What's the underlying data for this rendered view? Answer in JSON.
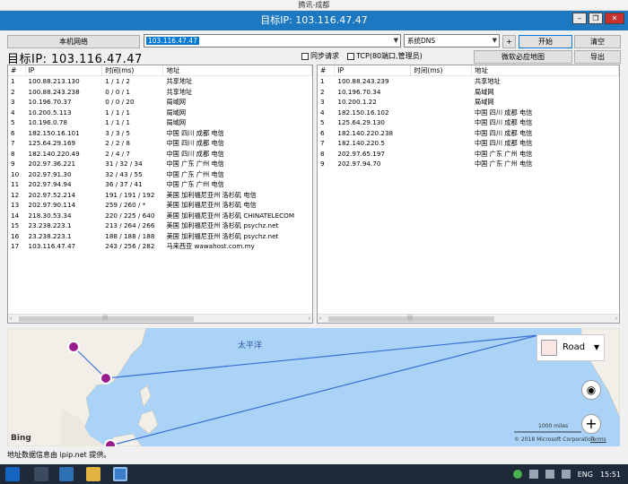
{
  "window": {
    "app_title": "腾讯-成都",
    "title": "目标IP: 103.116.47.47",
    "controls": {
      "minimize": "–",
      "restore": "❐",
      "close": "✕"
    }
  },
  "toolbar": {
    "local_network": "本机网络",
    "ip_value": "103.116.47.47",
    "dns_value": "系统DNS",
    "plus": "+",
    "start": "开始",
    "clear": "清空",
    "big_title": "目标IP:  103.116.47.47",
    "sync_request": "同步请求",
    "tcp_option": "TCP(80端口,管理员)",
    "weiruan_map": "微软必应地图",
    "export": "导出"
  },
  "left_table": {
    "headers": [
      "#",
      "IP",
      "时间(ms)",
      "地址"
    ],
    "rows": [
      [
        "1",
        "100.88.213.130",
        "1 / 1 / 2",
        "共享地址"
      ],
      [
        "2",
        "100.88.243.238",
        "0 / 0 / 1",
        "共享地址"
      ],
      [
        "3",
        "10.196.70.37",
        "0 / 0 / 20",
        "局域网"
      ],
      [
        "4",
        "10.200.5.113",
        "1 / 1 / 1",
        "局域网"
      ],
      [
        "5",
        "10.196.0.78",
        "1 / 1 / 1",
        "局域网"
      ],
      [
        "6",
        "182.150.16.101",
        "3 / 3 / 5",
        "中国 四川 成都 电信"
      ],
      [
        "7",
        "125.64.29.169",
        "2 / 2 / 8",
        "中国 四川 成都 电信"
      ],
      [
        "8",
        "182.140.220.49",
        "2 / 4 / 7",
        "中国 四川 成都 电信"
      ],
      [
        "9",
        "202.97.36.221",
        "31 / 32 / 34",
        "中国 广东 广州 电信"
      ],
      [
        "10",
        "202.97.91.30",
        "32 / 43 / 55",
        "中国 广东 广州 电信"
      ],
      [
        "11",
        "202.97.94.94",
        "36 / 37 / 41",
        "中国 广东 广州 电信"
      ],
      [
        "12",
        "202.97.52.214",
        "191 / 191 / 192",
        "美国 加利福尼亚州 洛杉矶 电信"
      ],
      [
        "13",
        "202.97.90.114",
        "259 / 260 / *",
        "美国 加利福尼亚州 洛杉矶 电信"
      ],
      [
        "14",
        "218.30.53.34",
        "220 / 225 / 640",
        "美国 加利福尼亚州 洛杉矶 CHINATELECOM"
      ],
      [
        "15",
        "23.238.223.1",
        "213 / 264 / 266",
        "美国 加利福尼亚州 洛杉矶 psychz.net"
      ],
      [
        "16",
        "23.238.223.1",
        "188 / 188 / 188",
        "美国 加利福尼亚州 洛杉矶 psychz.net"
      ],
      [
        "17",
        "103.116.47.47",
        "243 / 256 / 282",
        "马来西亚 wawahost.com.my"
      ]
    ]
  },
  "right_table": {
    "headers": [
      "#",
      "IP",
      "时间(ms)",
      "地址"
    ],
    "rows": [
      [
        "1",
        "100.88.243.239",
        "",
        "共享地址"
      ],
      [
        "2",
        "10.196.70.34",
        "",
        "局域网"
      ],
      [
        "3",
        "10.200.1.22",
        "",
        "局域网"
      ],
      [
        "4",
        "182.150.16.102",
        "",
        "中国 四川 成都 电信"
      ],
      [
        "5",
        "125.64.29.130",
        "",
        "中国 四川 成都 电信"
      ],
      [
        "6",
        "182.140.220.238",
        "",
        "中国 四川 成都 电信"
      ],
      [
        "7",
        "182.140.220.5",
        "",
        "中国 四川 成都 电信"
      ],
      [
        "8",
        "202.97.65.197",
        "",
        "中国 广东 广州 电信"
      ],
      [
        "9",
        "202.97.94.70",
        "",
        "中国 广东 广州 电信"
      ]
    ]
  },
  "scroll": {
    "left_arrow": "‹",
    "right_arrow": "›",
    "thumb": "|||"
  },
  "map": {
    "ocean_label": "太平洋",
    "road_label": "Road",
    "road_arrow": "▼",
    "bing": "Bing",
    "scale": "1000 miles",
    "copyright": "© 2018 Microsoft Corporation",
    "terms": "Terms",
    "locate": "◉",
    "zoom_in": "+"
  },
  "status": {
    "text": "地址数据信息由 ipip.net 提供。"
  },
  "taskbar": {
    "lang": "ENG",
    "time": "15:51"
  },
  "colors": {
    "titlebar": "#1c78c0",
    "accent": "#0078d7",
    "route": "#3a6fd8",
    "marker": "#9b1e8e",
    "taskbar": "#1e2a3a"
  }
}
